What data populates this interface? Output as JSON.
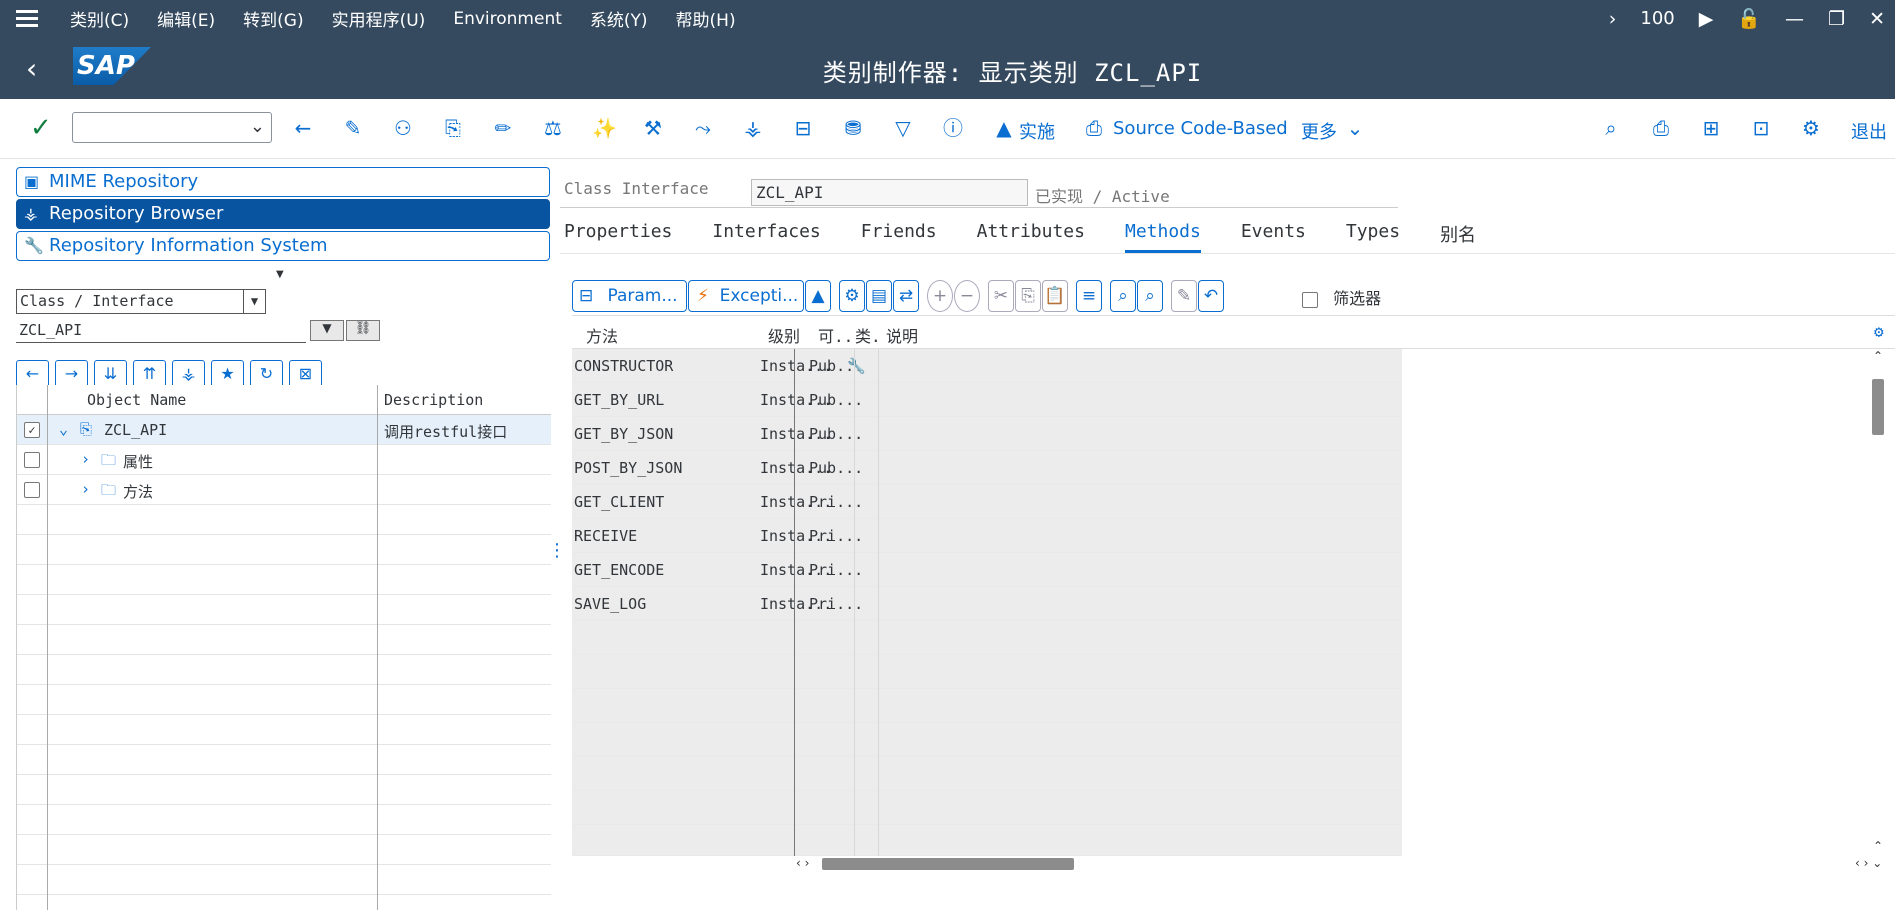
{
  "menubar": {
    "items": [
      "类别(C)",
      "编辑(E)",
      "转到(G)",
      "实用程序(U)",
      "Environment",
      "系统(Y)",
      "帮助(H)"
    ],
    "zoom": "100"
  },
  "titlebar": {
    "logo": "SAP",
    "title": "类别制作器: 显示类别 ZCL_API"
  },
  "toolbar": {
    "command_field": "",
    "impl_label": "实施",
    "source_label": "Source Code-Based",
    "more_label": "更多",
    "exit_label": "退出"
  },
  "left": {
    "repo_buttons": [
      "MIME Repository",
      "Repository Browser",
      "Repository Information System"
    ],
    "object_type": "Class / Interface",
    "object_name": "ZCL_API",
    "tree_headers": [
      "Object Name",
      "Description"
    ],
    "tree_rows": [
      {
        "name": "ZCL_API",
        "description": "调用restful接口",
        "checked": true
      },
      {
        "name": "属性",
        "description": "",
        "checked": false
      },
      {
        "name": "方法",
        "description": "",
        "checked": false
      }
    ]
  },
  "right": {
    "header_label": "Class Interface",
    "header_value": "ZCL_API",
    "header_status": "已实现 / Active",
    "tabs": [
      "Properties",
      "Interfaces",
      "Friends",
      "Attributes",
      "Methods",
      "Events",
      "Types",
      "别名"
    ],
    "active_tab": "Methods",
    "toolbar": {
      "params_label": "Param...",
      "except_label": "Excepti..."
    },
    "filter_label": "筛选器",
    "grid_headers": [
      "方法",
      "级别",
      "可..",
      "类.",
      "说明"
    ],
    "grid_rows": [
      {
        "method": "CONSTRUCTOR",
        "level": "Insta...",
        "vis": "Pub..."
      },
      {
        "method": "GET_BY_URL",
        "level": "Insta...",
        "vis": "Pub..."
      },
      {
        "method": "GET_BY_JSON",
        "level": "Insta...",
        "vis": "Pub..."
      },
      {
        "method": "POST_BY_JSON",
        "level": "Insta...",
        "vis": "Pub..."
      },
      {
        "method": "GET_CLIENT",
        "level": "Insta...",
        "vis": "Pri..."
      },
      {
        "method": "RECEIVE",
        "level": "Insta...",
        "vis": "Pri..."
      },
      {
        "method": "GET_ENCODE",
        "level": "Insta...",
        "vis": "Pri..."
      },
      {
        "method": "SAVE_LOG",
        "level": "Insta...",
        "vis": "Pri..."
      }
    ]
  }
}
